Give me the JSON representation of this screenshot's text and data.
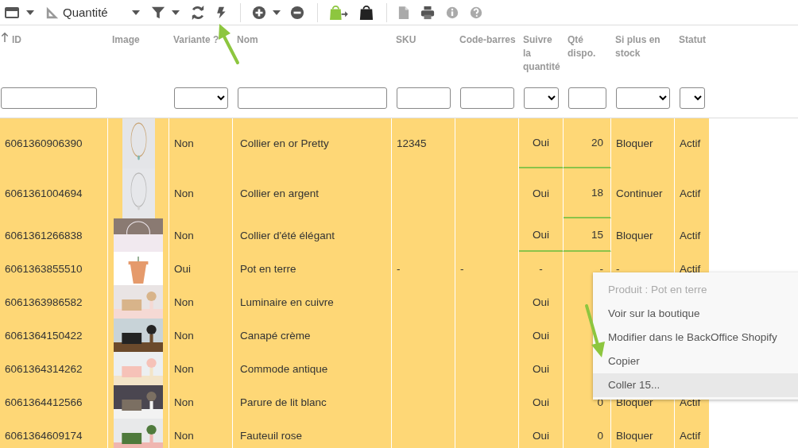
{
  "toolbar": {
    "measure_dropdown": "Quantité"
  },
  "columns": [
    {
      "label": "ID",
      "kind": "text",
      "sorted": true
    },
    {
      "label": "Image",
      "kind": "plain",
      "sorted": false
    },
    {
      "label": "Variante ?",
      "kind": "select",
      "sorted": false
    },
    {
      "label": "Nom",
      "kind": "text",
      "sorted": false
    },
    {
      "label": "SKU",
      "kind": "text",
      "sorted": false
    },
    {
      "label": "Code-barres",
      "kind": "text",
      "sorted": false
    },
    {
      "label": "Suivre la quantité",
      "kind": "select",
      "sorted": false
    },
    {
      "label": "Qté dispo.",
      "kind": "text",
      "sorted": false
    },
    {
      "label": "Si plus en stock",
      "kind": "select",
      "sorted": false
    },
    {
      "label": "Statut",
      "kind": "select",
      "sorted": false
    }
  ],
  "rows": [
    {
      "id": "6061360906390",
      "variant": "Non",
      "name": "Collier en or Pretty",
      "sku": "12345",
      "track": "Oui",
      "qty": "20",
      "out_of_stock": "Bloquer",
      "status": "Actif",
      "track_changed": true,
      "qty_changed": true
    },
    {
      "id": "6061361004694",
      "variant": "Non",
      "name": "Collier en argent",
      "track": "Oui",
      "qty": "18",
      "out_of_stock": "Continuer",
      "status": "Actif",
      "track_changed": false,
      "qty_changed": true
    },
    {
      "id": "6061361266838",
      "variant": "Non",
      "name": "Collier d'été élégant",
      "track": "Oui",
      "qty": "15",
      "out_of_stock": "Bloquer",
      "status": "Actif",
      "track_changed": true,
      "qty_changed": true
    },
    {
      "id": "6061363855510",
      "variant": "Oui",
      "name": "Pot en terre",
      "sku": "-",
      "barcode": "-",
      "track": "-",
      "qty": "-",
      "out_of_stock": "-",
      "status": "Actif",
      "track_changed": false,
      "qty_changed": false
    },
    {
      "id": "6061363986582",
      "variant": "Non",
      "name": "Luminaire en cuivre",
      "track": "Oui",
      "track_changed": false,
      "qty_changed": false
    },
    {
      "id": "6061364150422",
      "variant": "Non",
      "name": "Canapé crème",
      "track": "Oui",
      "track_changed": false,
      "qty_changed": false
    },
    {
      "id": "6061364314262",
      "variant": "Non",
      "name": "Commode antique",
      "track": "Oui",
      "track_changed": false,
      "qty_changed": false
    },
    {
      "id": "6061364412566",
      "variant": "Non",
      "name": "Parure de lit blanc",
      "track": "Oui",
      "qty": "0",
      "out_of_stock": "Bloquer",
      "status": "Actif",
      "track_changed": false,
      "qty_changed": false
    },
    {
      "id": "6061364609174",
      "variant": "Non",
      "name": "Fauteuil rose",
      "track": "Oui",
      "qty": "0",
      "out_of_stock": "Bloquer",
      "status": "Actif",
      "track_changed": false,
      "qty_changed": false
    }
  ],
  "context_menu": {
    "items": [
      {
        "label": "Produit : Pot en terre",
        "disabled": true,
        "selected": false
      },
      {
        "label": "Voir sur la boutique",
        "disabled": false,
        "selected": false
      },
      {
        "label": "Modifier dans le BackOffice Shopify",
        "disabled": false,
        "selected": false
      },
      {
        "label": "Copier",
        "disabled": false,
        "selected": false
      },
      {
        "label": "Coller 15...",
        "disabled": false,
        "selected": true
      }
    ]
  }
}
